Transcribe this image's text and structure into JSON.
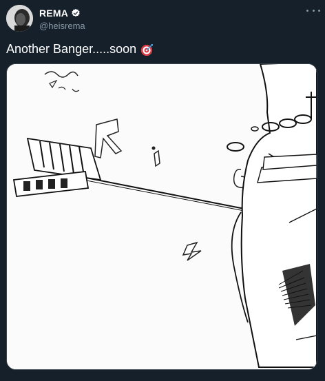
{
  "tweet": {
    "display_name": "REMA",
    "handle": "@heisrema",
    "verified": true,
    "text": "Another Banger.....soon",
    "emoji": "direct-hit-icon"
  },
  "media": {
    "description_icon": "artwork-illustration"
  },
  "colors": {
    "background": "#15202b",
    "verified": "#ffffff",
    "handle": "#8899a6",
    "emoji_red": "#e0323a"
  }
}
